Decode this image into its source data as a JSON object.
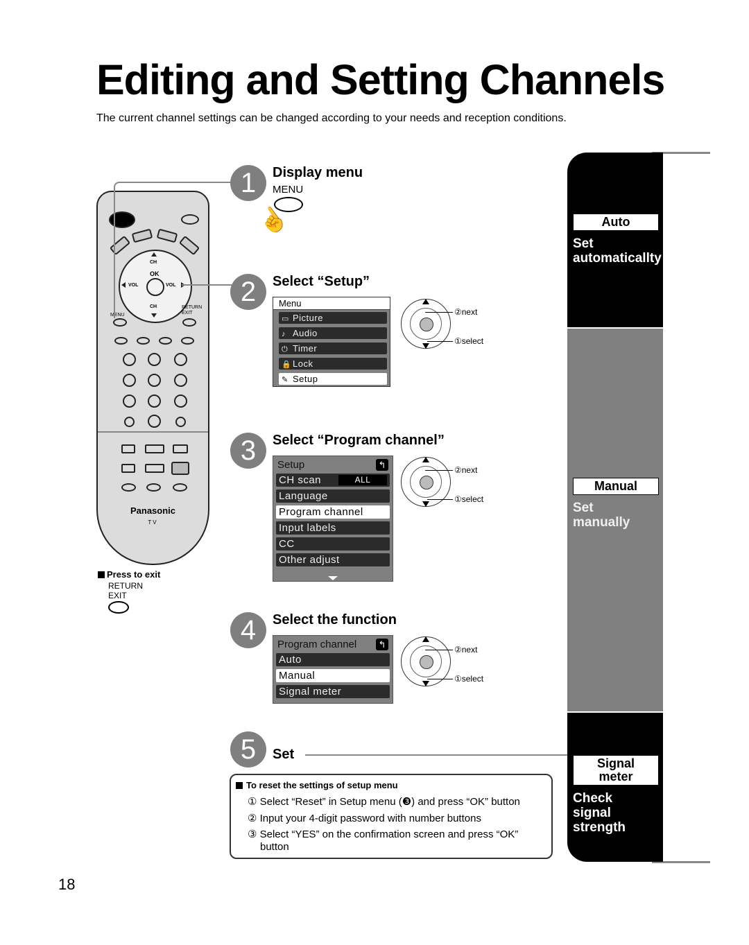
{
  "page": {
    "title": "Editing and Setting Channels",
    "subtitle": "The current channel settings can be changed according to your needs and reception conditions.",
    "page_number": "18"
  },
  "remote": {
    "brand": "Panasonic",
    "model_label": "TV",
    "labels": {
      "ch_up": "CH",
      "ok": "OK",
      "vol_left": "VOL",
      "vol_right": "VOL",
      "ch_down": "CH",
      "menu": "MENU",
      "return_exit": "RETURN\nEXIT"
    },
    "press_to_exit": {
      "title": "Press to exit",
      "return": "RETURN",
      "exit": "EXIT"
    }
  },
  "steps": [
    {
      "number": "1",
      "title": "Display menu",
      "button_label": "MENU"
    },
    {
      "number": "2",
      "title": "Select “Setup”"
    },
    {
      "number": "3",
      "title": "Select “Program channel”"
    },
    {
      "number": "4",
      "title": "Select the function"
    },
    {
      "number": "5",
      "title": "Set"
    }
  ],
  "dial": {
    "next_label": "②next",
    "select_label": "①select",
    "ok": "OK",
    "ch": "CH",
    "vol": "VOL"
  },
  "menu_osd": {
    "header": "Menu",
    "items": [
      {
        "icon": "picture-icon",
        "glyph": "▭",
        "label": "Picture",
        "selected": false
      },
      {
        "icon": "audio-icon",
        "glyph": "♪",
        "label": "Audio",
        "selected": false
      },
      {
        "icon": "timer-icon",
        "glyph": "⏻",
        "label": "Timer",
        "selected": false
      },
      {
        "icon": "lock-icon",
        "glyph": "🔒",
        "label": "Lock",
        "selected": false
      },
      {
        "icon": "setup-icon",
        "glyph": "✎",
        "label": "Setup",
        "selected": true
      }
    ]
  },
  "setup_osd": {
    "header": "Setup",
    "items": [
      {
        "label": "CH scan",
        "value": "ALL",
        "selected": false
      },
      {
        "label": "Language",
        "selected": false
      },
      {
        "label": "Program channel",
        "selected": true
      },
      {
        "label": "Input labels",
        "selected": false
      },
      {
        "label": "CC",
        "selected": false
      },
      {
        "label": "Other adjust",
        "selected": false
      }
    ]
  },
  "program_osd": {
    "header": "Program channel",
    "items": [
      {
        "label": "Auto",
        "selected": false
      },
      {
        "label": "Manual",
        "selected": true
      },
      {
        "label": "Signal meter",
        "selected": false
      }
    ]
  },
  "sidebar": {
    "auto": {
      "label": "Auto",
      "desc_1": "Set",
      "desc_2": "automaticallty"
    },
    "manual": {
      "label": "Manual",
      "desc_1": "Set",
      "desc_2": "manually"
    },
    "signal": {
      "label_1": "Signal",
      "label_2": "meter",
      "desc_1": "Check",
      "desc_2": "signal",
      "desc_3": "strength"
    }
  },
  "reset": {
    "title": "To reset the settings of setup menu",
    "items": [
      "① Select “Reset” in Setup menu (❸) and press “OK” button",
      "② Input your 4-digit password with number buttons",
      "③ Select “YES” on the confirmation screen and press “OK”",
      "button"
    ]
  }
}
